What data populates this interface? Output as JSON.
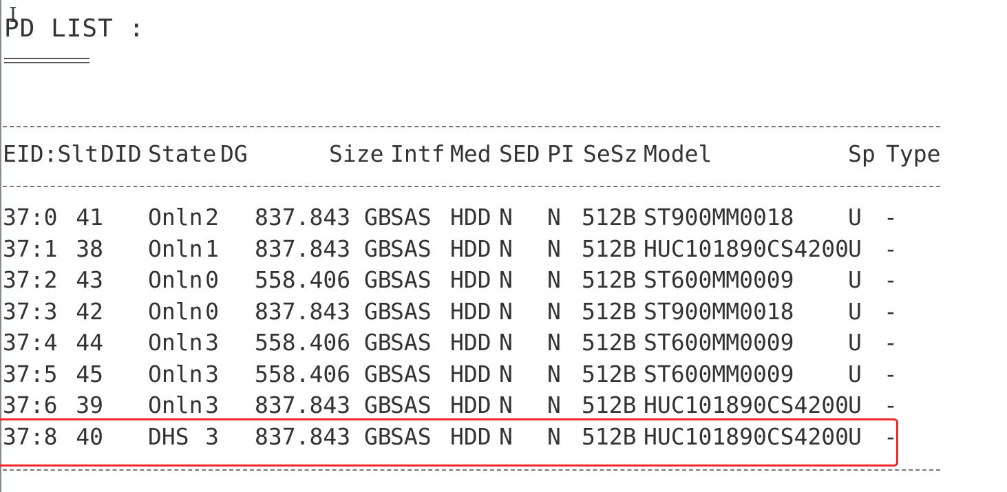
{
  "title": "PD LIST :",
  "columns": [
    "EID:Slt",
    "DID",
    "State",
    "DG",
    "Size",
    "Intf",
    "Med",
    "SED",
    "PI",
    "SeSz",
    "Model",
    "Sp",
    "Type"
  ],
  "rows": [
    {
      "eid_slt": "37:0",
      "did": "41",
      "state": "Onln",
      "dg": "2",
      "size": "837.843 GB",
      "intf": "SAS",
      "med": "HDD",
      "sed": "N",
      "pi": "N",
      "sesz": "512B",
      "model": "ST900MM0018",
      "sp": "U",
      "type": "-"
    },
    {
      "eid_slt": "37:1",
      "did": "38",
      "state": "Onln",
      "dg": "1",
      "size": "837.843 GB",
      "intf": "SAS",
      "med": "HDD",
      "sed": "N",
      "pi": "N",
      "sesz": "512B",
      "model": "HUC101890CS4200",
      "sp": "U",
      "type": "-"
    },
    {
      "eid_slt": "37:2",
      "did": "43",
      "state": "Onln",
      "dg": "0",
      "size": "558.406 GB",
      "intf": "SAS",
      "med": "HDD",
      "sed": "N",
      "pi": "N",
      "sesz": "512B",
      "model": "ST600MM0009",
      "sp": "U",
      "type": "-"
    },
    {
      "eid_slt": "37:3",
      "did": "42",
      "state": "Onln",
      "dg": "0",
      "size": "837.843 GB",
      "intf": "SAS",
      "med": "HDD",
      "sed": "N",
      "pi": "N",
      "sesz": "512B",
      "model": "ST900MM0018",
      "sp": "U",
      "type": "-"
    },
    {
      "eid_slt": "37:4",
      "did": "44",
      "state": "Onln",
      "dg": "3",
      "size": "558.406 GB",
      "intf": "SAS",
      "med": "HDD",
      "sed": "N",
      "pi": "N",
      "sesz": "512B",
      "model": "ST600MM0009",
      "sp": "U",
      "type": "-"
    },
    {
      "eid_slt": "37:5",
      "did": "45",
      "state": "Onln",
      "dg": "3",
      "size": "558.406 GB",
      "intf": "SAS",
      "med": "HDD",
      "sed": "N",
      "pi": "N",
      "sesz": "512B",
      "model": "ST600MM0009",
      "sp": "U",
      "type": "-"
    },
    {
      "eid_slt": "37:6",
      "did": "39",
      "state": "Onln",
      "dg": "3",
      "size": "837.843 GB",
      "intf": "SAS",
      "med": "HDD",
      "sed": "N",
      "pi": "N",
      "sesz": "512B",
      "model": "HUC101890CS4200",
      "sp": "U",
      "type": "-"
    },
    {
      "eid_slt": "37:8",
      "did": "40",
      "state": "DHS",
      "dg": "3",
      "size": "837.843 GB",
      "intf": "SAS",
      "med": "HDD",
      "sed": "N",
      "pi": "N",
      "sesz": "512B",
      "model": "HUC101890CS4200",
      "sp": "U",
      "type": "-"
    }
  ],
  "highlight": {
    "row_index": 7,
    "color": "#ee2a2a"
  },
  "icons": {
    "cursor": "text-cursor-icon"
  }
}
